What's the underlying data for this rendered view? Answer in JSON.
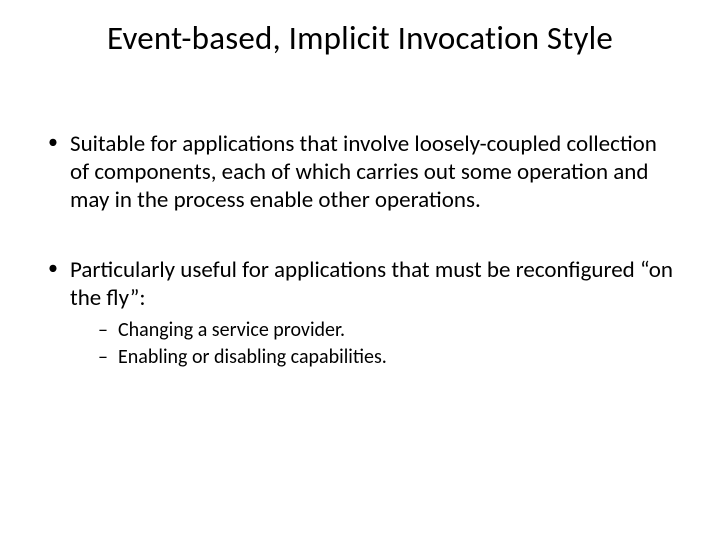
{
  "title": "Event-based, Implicit Invocation Style",
  "bullets": [
    {
      "text": "Suitable for applications that involve loosely-coupled collection of components, each of which carries out some operation and may in the process enable other operations."
    },
    {
      "text": "Particularly useful for applications that must be reconfigured “on the fly”:",
      "sub": [
        "Changing a service provider.",
        "Enabling or disabling capabilities."
      ]
    }
  ]
}
